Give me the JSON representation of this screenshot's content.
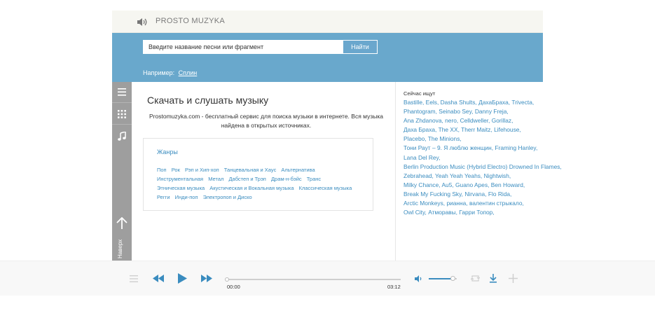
{
  "header": {
    "logo_text": "PROSTO MUZYKA",
    "logo_icon": "speaker-icon"
  },
  "search": {
    "value": "Введите название песни или фрагмент",
    "button_label": "Найти",
    "example_label": "Например:",
    "example_link": "Сплин"
  },
  "sidebar": {
    "items": [
      {
        "icon": "menu-icon"
      },
      {
        "icon": "grid-icon"
      },
      {
        "icon": "music-note-icon"
      }
    ],
    "up_icon": "arrow-up-icon",
    "up_label": "Наверх"
  },
  "main": {
    "title": "Скачать и слушать музыку",
    "description": "Prostomuzyka.com - бесплатный сервис для поиска музыки в интернете. Вся музыка найдена в открытых источниках.",
    "genres_title": "Жанры",
    "genres": [
      "Поп",
      "Рок",
      "Рэп и Хип-хоп",
      "Танцевальная и Хаус",
      "Альтернатива",
      "Инструментальная",
      "Метал",
      "Дабстеп и Трэп",
      "Драм-н-бэйс",
      "Транс",
      "Этническая музыка",
      "Акустическая и Вокальная музыка",
      "Классическая музыка",
      "Регги",
      "Инди-поп",
      "Электропоп и Диско"
    ]
  },
  "now_searching": {
    "title": "Сейчас ищут",
    "items": [
      "Bastille,",
      "Eels,",
      "Dasha Shults,",
      "ДахаБраха,",
      "Trivecta,",
      "Phantogram,",
      "Seinabo Sey,",
      "Danny Freja,",
      "Ana Zhdanova,",
      "nero,",
      "Celldweller,",
      "Gorillaz,",
      "Даха Браха,",
      "The XX,",
      "Therr Maitz,",
      "Lifehouse,",
      "Placebo,",
      "The Minions,",
      "Тони Раут – 9. Я люблю женщин,",
      "Framing Hanley,",
      "Lana Del Rey,",
      "Berlin Production Music (Hybrid Electro) Drowned In Flames,",
      "Zebrahead,",
      "Yeah Yeah Yeahs,",
      "Nightwish,",
      "Milky Chance,",
      "Au5,",
      "Guano Apes,",
      "Ben Howard,",
      "Break My Fucking Sky,",
      "Nirvana,",
      "Flo Rida,",
      "Arctic Monkeys,",
      "рианна,",
      "валентин стрыкало,",
      "Owl City,",
      "Атморавы,",
      "Гарри Топор,"
    ]
  },
  "player": {
    "time_current": "00:00",
    "time_total": "03:12",
    "progress": 0,
    "volume": 0.85,
    "accent_color": "#3a8cbf",
    "icons": [
      "playlist-icon",
      "previous-icon",
      "play-icon",
      "next-icon",
      "volume-icon",
      "repeat-icon",
      "download-icon",
      "add-icon"
    ]
  }
}
